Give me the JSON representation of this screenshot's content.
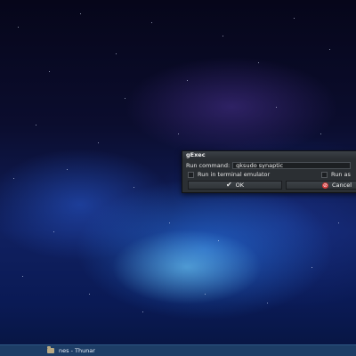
{
  "dialog": {
    "title": "gExec",
    "run_command_label": "Run command:",
    "command_value": "gksudo synaptic",
    "run_in_terminal_label": "Run in terminal emulator",
    "run_as_label": "Run as",
    "ok_label": "OK",
    "cancel_label": "Cancel",
    "ok_icon": "checkmark-icon",
    "cancel_icon": "cancel-icon"
  },
  "taskbar": {
    "task_label": "nes - Thunar",
    "task_icon": "folder-icon"
  },
  "colors": {
    "dialog_bg": "#2b2f33",
    "taskbar_bg": "#1d3d66",
    "cancel_red": "#d23a3a"
  }
}
